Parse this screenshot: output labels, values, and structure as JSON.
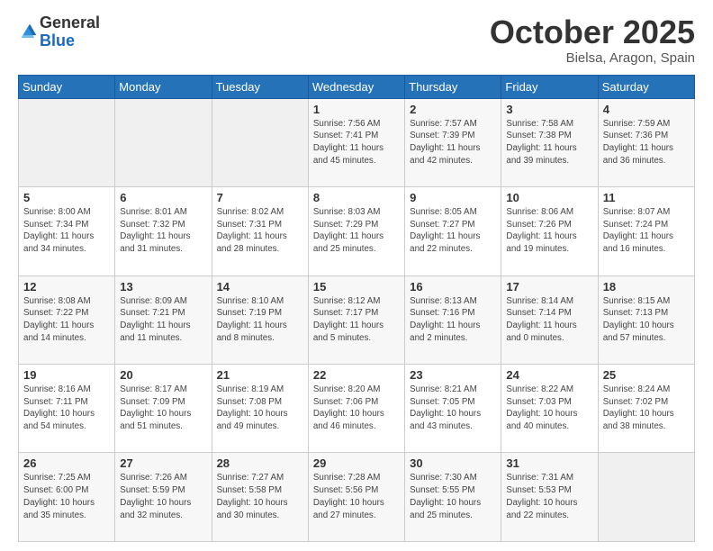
{
  "logo": {
    "general": "General",
    "blue": "Blue"
  },
  "title": {
    "month": "October 2025",
    "location": "Bielsa, Aragon, Spain"
  },
  "header_days": [
    "Sunday",
    "Monday",
    "Tuesday",
    "Wednesday",
    "Thursday",
    "Friday",
    "Saturday"
  ],
  "weeks": [
    [
      {
        "day": "",
        "info": ""
      },
      {
        "day": "",
        "info": ""
      },
      {
        "day": "",
        "info": ""
      },
      {
        "day": "1",
        "info": "Sunrise: 7:56 AM\nSunset: 7:41 PM\nDaylight: 11 hours\nand 45 minutes."
      },
      {
        "day": "2",
        "info": "Sunrise: 7:57 AM\nSunset: 7:39 PM\nDaylight: 11 hours\nand 42 minutes."
      },
      {
        "day": "3",
        "info": "Sunrise: 7:58 AM\nSunset: 7:38 PM\nDaylight: 11 hours\nand 39 minutes."
      },
      {
        "day": "4",
        "info": "Sunrise: 7:59 AM\nSunset: 7:36 PM\nDaylight: 11 hours\nand 36 minutes."
      }
    ],
    [
      {
        "day": "5",
        "info": "Sunrise: 8:00 AM\nSunset: 7:34 PM\nDaylight: 11 hours\nand 34 minutes."
      },
      {
        "day": "6",
        "info": "Sunrise: 8:01 AM\nSunset: 7:32 PM\nDaylight: 11 hours\nand 31 minutes."
      },
      {
        "day": "7",
        "info": "Sunrise: 8:02 AM\nSunset: 7:31 PM\nDaylight: 11 hours\nand 28 minutes."
      },
      {
        "day": "8",
        "info": "Sunrise: 8:03 AM\nSunset: 7:29 PM\nDaylight: 11 hours\nand 25 minutes."
      },
      {
        "day": "9",
        "info": "Sunrise: 8:05 AM\nSunset: 7:27 PM\nDaylight: 11 hours\nand 22 minutes."
      },
      {
        "day": "10",
        "info": "Sunrise: 8:06 AM\nSunset: 7:26 PM\nDaylight: 11 hours\nand 19 minutes."
      },
      {
        "day": "11",
        "info": "Sunrise: 8:07 AM\nSunset: 7:24 PM\nDaylight: 11 hours\nand 16 minutes."
      }
    ],
    [
      {
        "day": "12",
        "info": "Sunrise: 8:08 AM\nSunset: 7:22 PM\nDaylight: 11 hours\nand 14 minutes."
      },
      {
        "day": "13",
        "info": "Sunrise: 8:09 AM\nSunset: 7:21 PM\nDaylight: 11 hours\nand 11 minutes."
      },
      {
        "day": "14",
        "info": "Sunrise: 8:10 AM\nSunset: 7:19 PM\nDaylight: 11 hours\nand 8 minutes."
      },
      {
        "day": "15",
        "info": "Sunrise: 8:12 AM\nSunset: 7:17 PM\nDaylight: 11 hours\nand 5 minutes."
      },
      {
        "day": "16",
        "info": "Sunrise: 8:13 AM\nSunset: 7:16 PM\nDaylight: 11 hours\nand 2 minutes."
      },
      {
        "day": "17",
        "info": "Sunrise: 8:14 AM\nSunset: 7:14 PM\nDaylight: 11 hours\nand 0 minutes."
      },
      {
        "day": "18",
        "info": "Sunrise: 8:15 AM\nSunset: 7:13 PM\nDaylight: 10 hours\nand 57 minutes."
      }
    ],
    [
      {
        "day": "19",
        "info": "Sunrise: 8:16 AM\nSunset: 7:11 PM\nDaylight: 10 hours\nand 54 minutes."
      },
      {
        "day": "20",
        "info": "Sunrise: 8:17 AM\nSunset: 7:09 PM\nDaylight: 10 hours\nand 51 minutes."
      },
      {
        "day": "21",
        "info": "Sunrise: 8:19 AM\nSunset: 7:08 PM\nDaylight: 10 hours\nand 49 minutes."
      },
      {
        "day": "22",
        "info": "Sunrise: 8:20 AM\nSunset: 7:06 PM\nDaylight: 10 hours\nand 46 minutes."
      },
      {
        "day": "23",
        "info": "Sunrise: 8:21 AM\nSunset: 7:05 PM\nDaylight: 10 hours\nand 43 minutes."
      },
      {
        "day": "24",
        "info": "Sunrise: 8:22 AM\nSunset: 7:03 PM\nDaylight: 10 hours\nand 40 minutes."
      },
      {
        "day": "25",
        "info": "Sunrise: 8:24 AM\nSunset: 7:02 PM\nDaylight: 10 hours\nand 38 minutes."
      }
    ],
    [
      {
        "day": "26",
        "info": "Sunrise: 7:25 AM\nSunset: 6:00 PM\nDaylight: 10 hours\nand 35 minutes."
      },
      {
        "day": "27",
        "info": "Sunrise: 7:26 AM\nSunset: 5:59 PM\nDaylight: 10 hours\nand 32 minutes."
      },
      {
        "day": "28",
        "info": "Sunrise: 7:27 AM\nSunset: 5:58 PM\nDaylight: 10 hours\nand 30 minutes."
      },
      {
        "day": "29",
        "info": "Sunrise: 7:28 AM\nSunset: 5:56 PM\nDaylight: 10 hours\nand 27 minutes."
      },
      {
        "day": "30",
        "info": "Sunrise: 7:30 AM\nSunset: 5:55 PM\nDaylight: 10 hours\nand 25 minutes."
      },
      {
        "day": "31",
        "info": "Sunrise: 7:31 AM\nSunset: 5:53 PM\nDaylight: 10 hours\nand 22 minutes."
      },
      {
        "day": "",
        "info": ""
      }
    ]
  ]
}
